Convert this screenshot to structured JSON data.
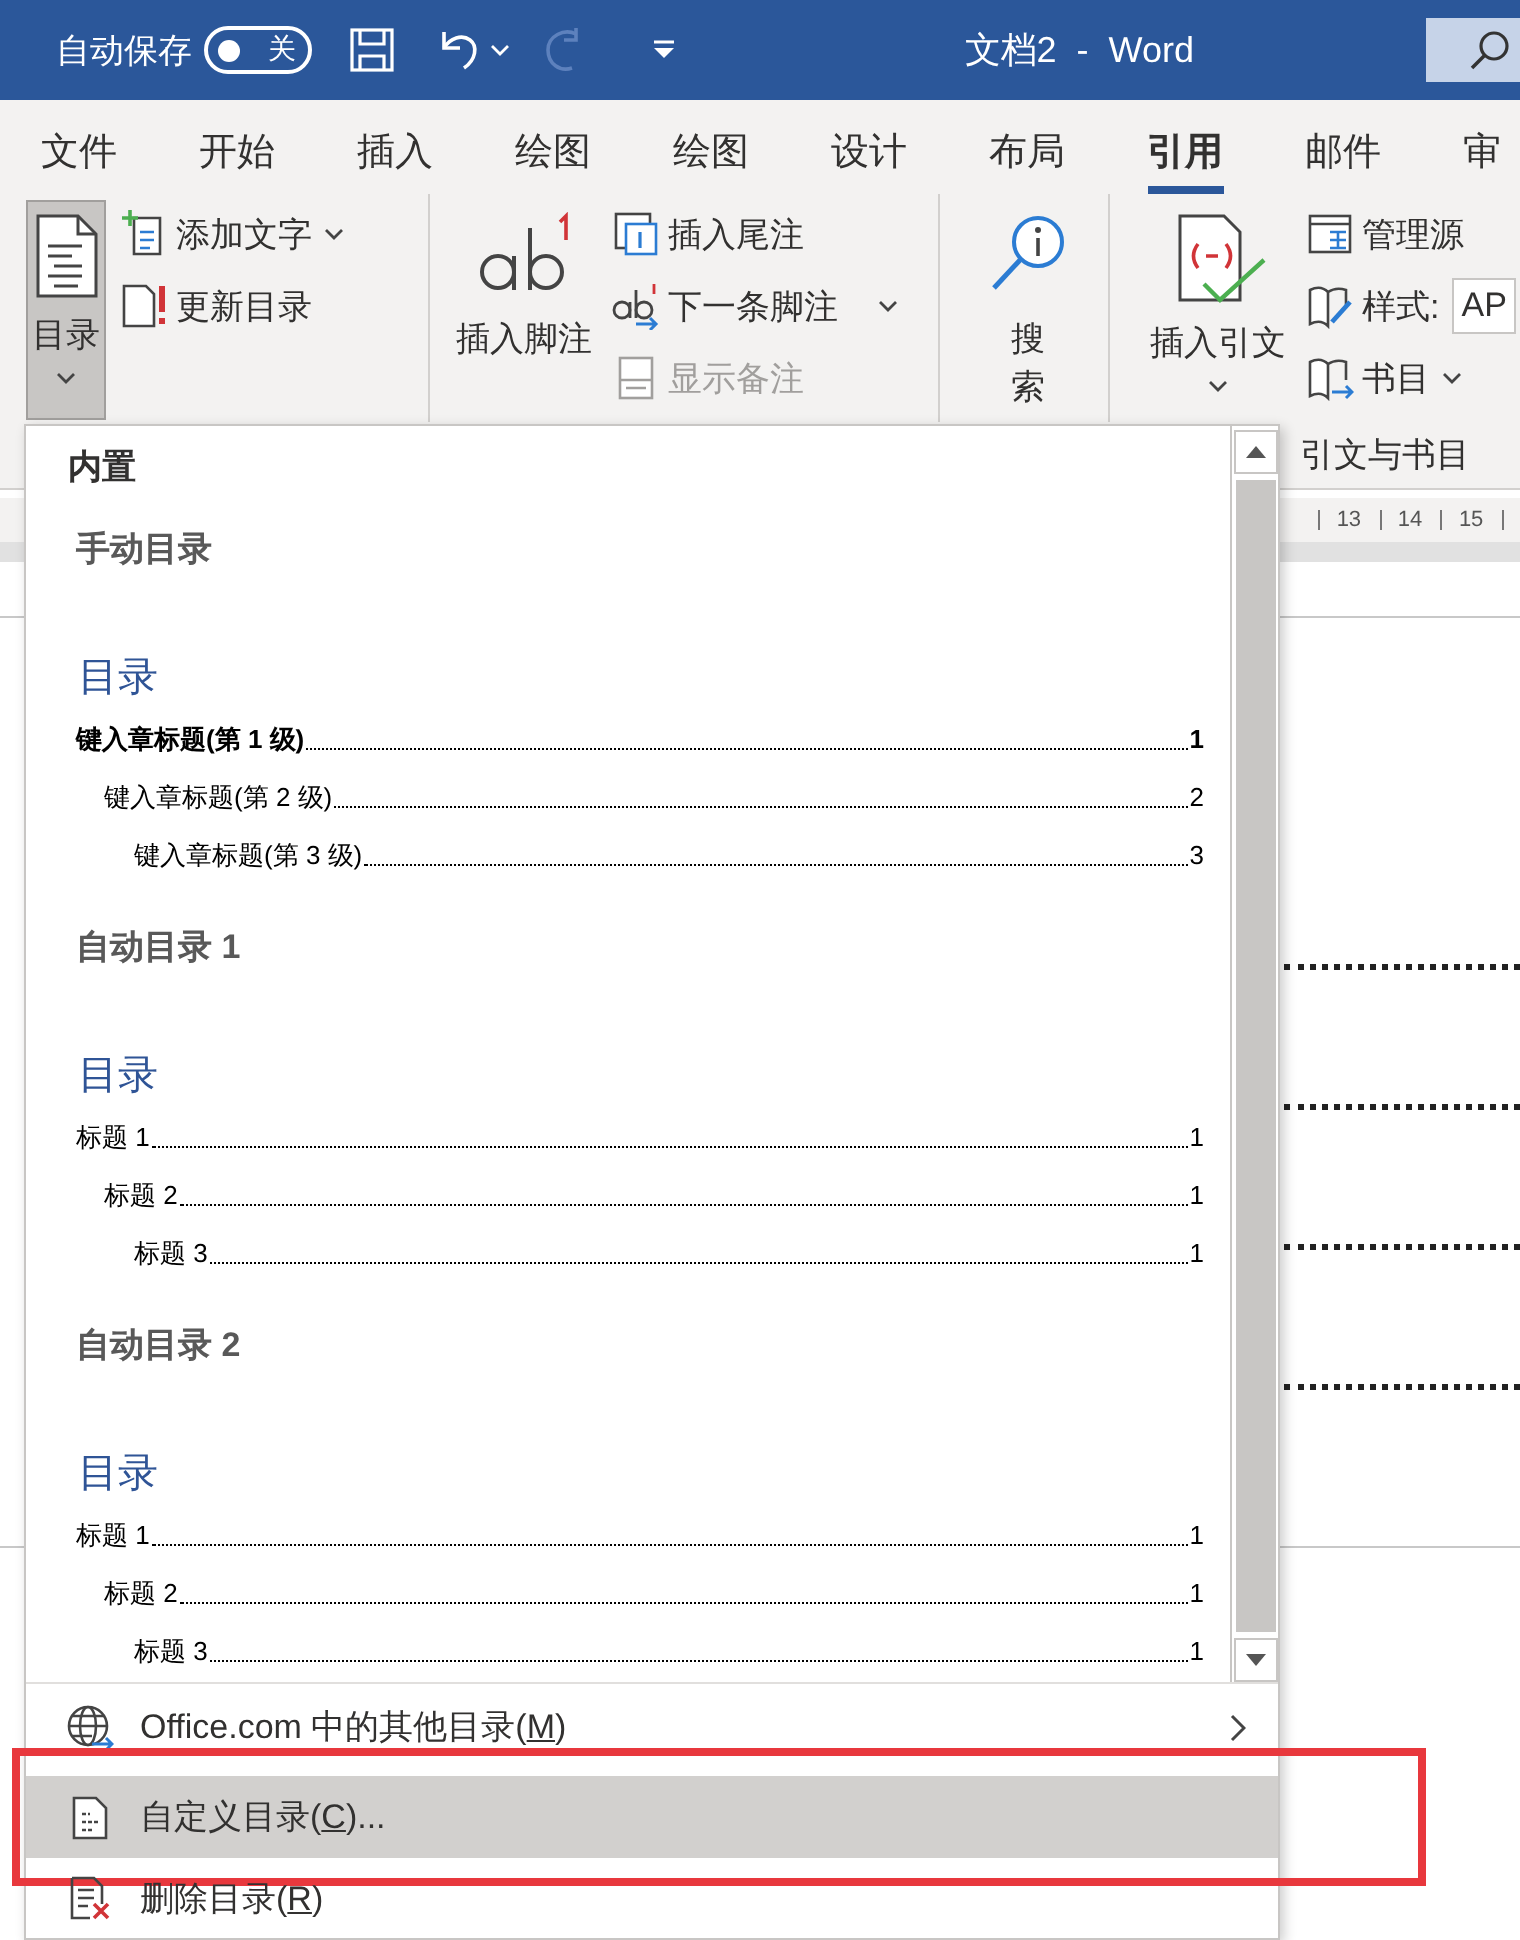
{
  "title_bar": {
    "autosave_label": "自动保存",
    "autosave": {
      "on": false,
      "label": "关"
    },
    "redo": {
      "disabled": true
    },
    "document_title": "文档2  -  Word"
  },
  "tabs": [
    {
      "label": "文件",
      "selected": false
    },
    {
      "label": "开始",
      "selected": false
    },
    {
      "label": "插入",
      "selected": false
    },
    {
      "label": "绘图",
      "selected": false
    },
    {
      "label": "绘图",
      "selected": false
    },
    {
      "label": "设计",
      "selected": false
    },
    {
      "label": "布局",
      "selected": false
    },
    {
      "label": "引用",
      "selected": true
    },
    {
      "label": "邮件",
      "selected": false
    },
    {
      "label": "审",
      "selected": false
    }
  ],
  "ribbon": {
    "groups": [
      {
        "large": {
          "label": "目录",
          "pressed": true,
          "dropdown": true
        },
        "small": [
          {
            "label": "添加文字",
            "dropdown": true,
            "disabled": false
          },
          {
            "label": "更新目录",
            "dropdown": false,
            "disabled": false
          }
        ]
      },
      {
        "large": {
          "label": "插入脚注",
          "pressed": false,
          "dropdown": false
        },
        "small": [
          {
            "label": "插入尾注",
            "dropdown": false,
            "disabled": false
          },
          {
            "label": "下一条脚注",
            "dropdown": true,
            "disabled": false
          },
          {
            "label": "显示备注",
            "dropdown": false,
            "disabled": true
          }
        ]
      },
      {
        "large": {
          "label": "搜索",
          "pressed": false,
          "dropdown": false
        }
      },
      {
        "large": {
          "label": "插入引文",
          "pressed": false,
          "dropdown": true
        },
        "small": [
          {
            "label": "管理源",
            "dropdown": false,
            "disabled": false
          },
          {
            "label": "样式:",
            "field": "AP",
            "dropdown": false,
            "disabled": false
          },
          {
            "label": "书目",
            "dropdown": true,
            "disabled": false
          }
        ],
        "label": "引文与书目"
      }
    ]
  },
  "ruler": {
    "marks": [
      "13",
      "14",
      "15"
    ]
  },
  "toc_menu": {
    "heading": "内置",
    "gallery": [
      {
        "title": "手动目录",
        "preview": {
          "heading": "目录",
          "entries": [
            {
              "text": "键入章标题(第 1 级)",
              "page": "1",
              "emphasized": true,
              "children": [
                {
                  "text": "键入章标题(第 2 级)",
                  "page": "2",
                  "emphasized": false,
                  "children": [
                    {
                      "text": "键入章标题(第 3 级)",
                      "page": "3",
                      "emphasized": false
                    }
                  ]
                }
              ]
            }
          ]
        }
      },
      {
        "title": "自动目录 1",
        "preview": {
          "heading": "目录",
          "entries": [
            {
              "text": "标题 1",
              "page": "1",
              "emphasized": false,
              "children": [
                {
                  "text": "标题 2",
                  "page": "1",
                  "emphasized": false,
                  "children": [
                    {
                      "text": "标题 3",
                      "page": "1",
                      "emphasized": false
                    }
                  ]
                }
              ]
            }
          ]
        }
      },
      {
        "title": "自动目录 2",
        "preview": {
          "heading": "目录",
          "entries": [
            {
              "text": "标题 1",
              "page": "1",
              "emphasized": false,
              "children": [
                {
                  "text": "标题 2",
                  "page": "1",
                  "emphasized": false,
                  "children": [
                    {
                      "text": "标题 3",
                      "page": "1",
                      "emphasized": false
                    }
                  ]
                }
              ]
            }
          ]
        }
      }
    ],
    "actions": [
      {
        "label_start": "Office.com 中的其他目录(",
        "access_key": "M",
        "label_end": ")",
        "submenu": true,
        "highlighted": false
      },
      {
        "label_start": "自定义目录(",
        "access_key": "C",
        "label_end": ")...",
        "submenu": false,
        "highlighted": true
      },
      {
        "label_start": "删除目录(",
        "access_key": "R",
        "label_end": ")",
        "submenu": false,
        "highlighted": false
      }
    ]
  }
}
